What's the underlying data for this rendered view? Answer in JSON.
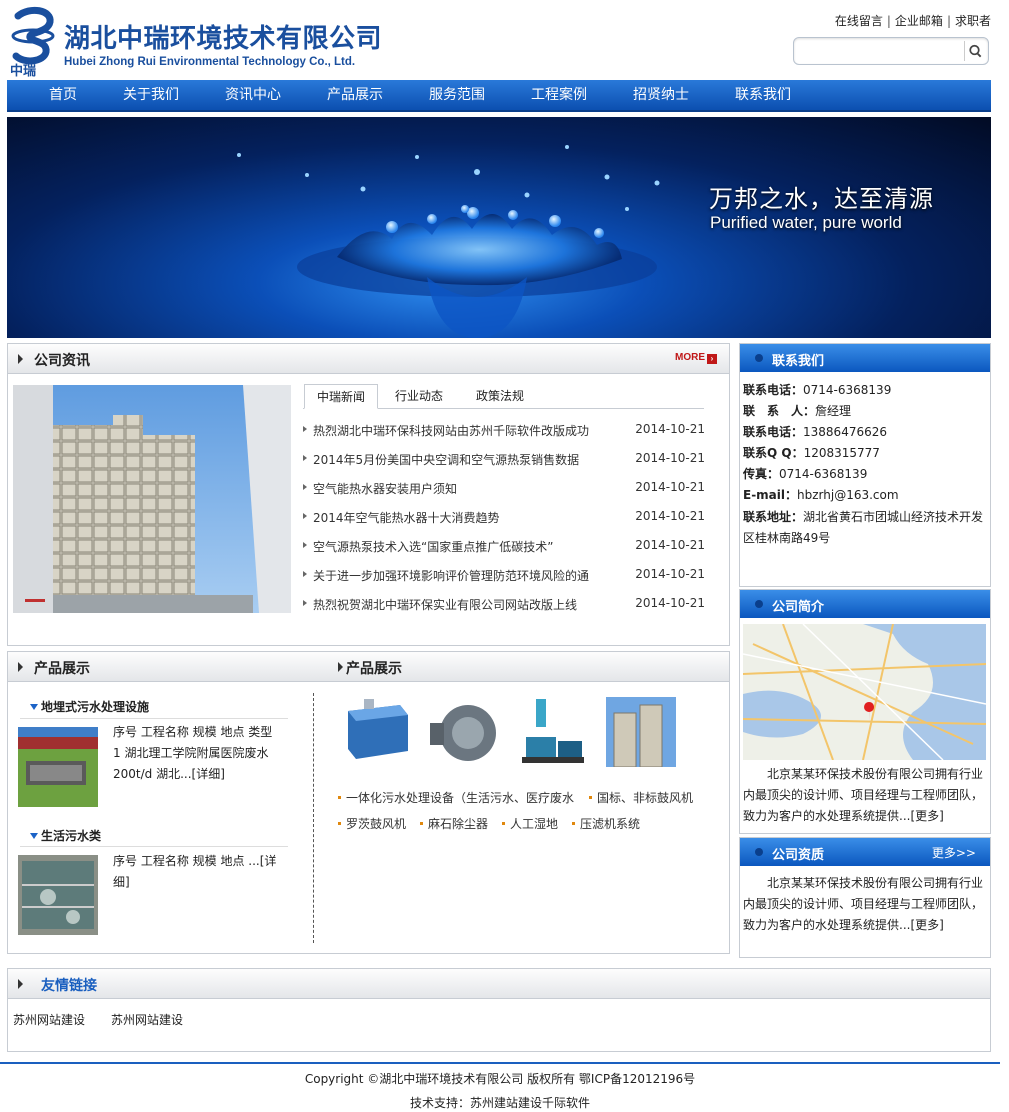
{
  "header": {
    "logo_mark_text": "中瑞",
    "logo_cn": "湖北中瑞环境技术有限公司",
    "logo_en": "Hubei Zhong Rui Environmental Technology Co., Ltd.",
    "top_links": [
      "在线留言",
      "企业邮箱",
      "求职者"
    ],
    "search_placeholder": ""
  },
  "nav": [
    "首页",
    "关于我们",
    "资讯中心",
    "产品展示",
    "服务范围",
    "工程案例",
    "招贤纳士",
    "联系我们"
  ],
  "banner": {
    "title": "万邦之水，达至清源",
    "subtitle": "Purified water, pure world"
  },
  "news": {
    "title": "公司资讯",
    "more": "MORE",
    "tabs": [
      "中瑞新闻",
      "行业动态",
      "政策法规"
    ],
    "items": [
      {
        "title": "热烈湖北中瑞环保科技网站由苏州千际软件改版成功",
        "date": "2014-10-21"
      },
      {
        "title": "2014年5月份美国中央空调和空气源热泵销售数据",
        "date": "2014-10-21"
      },
      {
        "title": "空气能热水器安装用户须知",
        "date": "2014-10-21"
      },
      {
        "title": "2014年空气能热水器十大消费趋势",
        "date": "2014-10-21"
      },
      {
        "title": "空气源热泵技术入选“国家重点推广低碳技术”",
        "date": "2014-10-21"
      },
      {
        "title": "关于进一步加强环境影响评价管理防范环境风险的通",
        "date": "2014-10-21"
      },
      {
        "title": "热烈祝贺湖北中瑞环保实业有限公司网站改版上线",
        "date": "2014-10-21"
      }
    ]
  },
  "products_left": {
    "title": "产品展示",
    "categories": [
      {
        "name": "地埋式污水处理设施",
        "text": "序号 工程名称 规模 地点 类型 1 湖北理工学院附属医院废水 200t/d 湖北...[详细]"
      },
      {
        "name": "生活污水类",
        "text": "序号 工程名称 规模 地点 ...[详细]"
      }
    ]
  },
  "products_right": {
    "title": "产品展示",
    "links": [
      "一体化污水处理设备（生活污水、医疗废水",
      "国标、非标鼓风机",
      "罗茨鼓风机",
      "麻石除尘器",
      "人工湿地",
      "压滤机系统"
    ]
  },
  "contact": {
    "title": "联系我们",
    "lines": [
      {
        "label": "联系电话：",
        "value": "0714-6368139"
      },
      {
        "label": "联　系　人：",
        "value": "詹经理"
      },
      {
        "label": "联系电话：",
        "value": "13886476626"
      },
      {
        "label": "联系Q Q：",
        "value": "1208315777"
      },
      {
        "label": "传真：",
        "value": "0714-6368139"
      },
      {
        "label": "E-mail：",
        "value": "hbzrhj@163.com"
      },
      {
        "label": "联系地址：",
        "value": "湖北省黄石市团城山经济技术开发区桂林南路49号"
      }
    ]
  },
  "intro": {
    "title": "公司简介",
    "text": "北京某某环保技术股份有限公司拥有行业内最顶尖的设计师、项目经理与工程师团队，致力为客户的水处理系统提供...[更多]"
  },
  "quality": {
    "title": "公司资质",
    "more": "更多>>",
    "text": "北京某某环保技术股份有限公司拥有行业内最顶尖的设计师、项目经理与工程师团队，致力为客户的水处理系统提供...[更多]"
  },
  "links": {
    "title": "友情链接",
    "items": [
      "苏州网站建设",
      "苏州网站建设"
    ]
  },
  "footer": {
    "copyright": "Copyright ©湖北中瑞环境技术有限公司 版权所有  鄂ICP备12012196号",
    "support": "技术支持：苏州建站建设千际软件"
  },
  "colors": {
    "brand": "#1a4f9e",
    "nav": "#0c4fb0",
    "more": "#c01818"
  }
}
